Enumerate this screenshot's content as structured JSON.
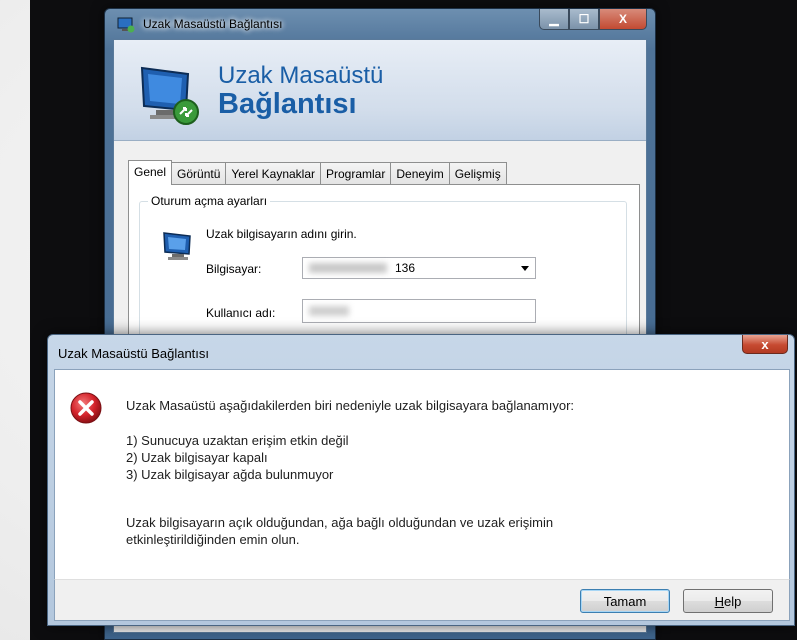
{
  "main_window": {
    "title": "Uzak Masaüstü Bağlantısı",
    "banner_line1": "Uzak Masaüstü",
    "banner_line2": "Bağlantısı",
    "controls": {
      "minimize": "▁",
      "maximize": "☐",
      "close": "X"
    },
    "tabs": [
      {
        "label": "Genel",
        "active": true
      },
      {
        "label": "Görüntü",
        "active": false
      },
      {
        "label": "Yerel Kaynaklar",
        "active": false
      },
      {
        "label": "Programlar",
        "active": false
      },
      {
        "label": "Deneyim",
        "active": false
      },
      {
        "label": "Gelişmiş",
        "active": false
      }
    ],
    "group_title": "Oturum açma ayarları",
    "instruction": "Uzak bilgisayarın adını girin.",
    "computer_label": "Bilgisayar:",
    "computer_value_visible": "136",
    "username_label": "Kullanıcı adı:"
  },
  "error_dialog": {
    "title": "Uzak Masaüstü Bağlantısı",
    "close_glyph": "x",
    "icon": "error-icon",
    "message": "Uzak Masaüstü aşağıdakilerden biri nedeniyle uzak bilgisayara bağlanamıyor:",
    "reasons": [
      "1) Sunucuya uzaktan erişim etkin değil",
      "2) Uzak bilgisayar kapalı",
      "3) Uzak bilgisayar ağda bulunmuyor"
    ],
    "advice_line1": "Uzak bilgisayarın açık olduğundan, ağa bağlı olduğundan ve uzak erişimin",
    "advice_line2": "etkinleştirildiğinden emin olun.",
    "ok_label": "Tamam",
    "help_label_first": "H",
    "help_label_rest": "elp"
  },
  "colors": {
    "title_blue": "#1a5ea6",
    "error_red": "#d4232b"
  }
}
